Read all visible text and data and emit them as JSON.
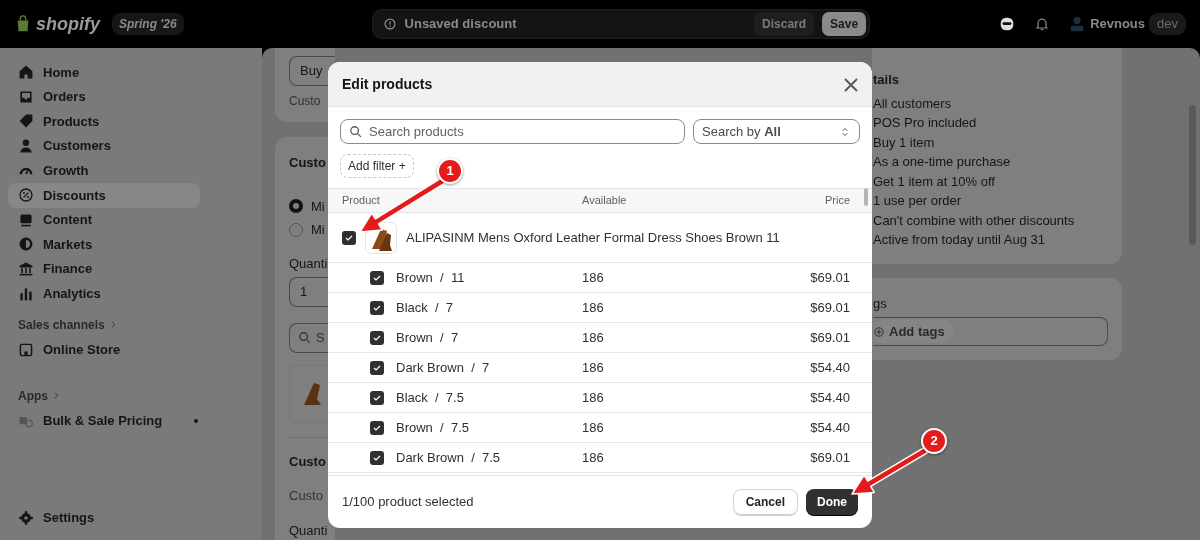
{
  "top_bar": {
    "logo": "shopify",
    "edition": "Spring '26",
    "notice": "Unsaved discount",
    "discard": "Discard",
    "save": "Save",
    "user": "Revnous",
    "user_badge": "dev"
  },
  "sidebar": {
    "items": [
      {
        "label": "Home",
        "selected": false
      },
      {
        "label": "Orders",
        "selected": false
      },
      {
        "label": "Products",
        "selected": false
      },
      {
        "label": "Customers",
        "selected": false
      },
      {
        "label": "Growth",
        "selected": false
      },
      {
        "label": "Discounts",
        "selected": true
      },
      {
        "label": "Content",
        "selected": false
      },
      {
        "label": "Markets",
        "selected": false
      },
      {
        "label": "Finance",
        "selected": false
      },
      {
        "label": "Analytics",
        "selected": false
      }
    ],
    "sales_channels": {
      "heading": "Sales channels",
      "items": [
        {
          "label": "Online Store",
          "selected": false
        }
      ]
    },
    "apps": {
      "heading": "Apps",
      "items": [
        {
          "label": "Bulk & Sale Pricing",
          "selected": false
        }
      ]
    },
    "settings": {
      "label": "Settings",
      "selected": false
    }
  },
  "main": {
    "method_card": {
      "value": "Buy",
      "caption": "Custo"
    },
    "requirements_card": {
      "heading": "Custo",
      "options": [
        {
          "label": "Mi",
          "selected": true
        },
        {
          "label": "Mi",
          "selected": false
        }
      ],
      "quantity_label": "Quanti",
      "quantity_value": "1",
      "search_placeholder": "S",
      "gets_heading": "Custo",
      "gets_caption": "Custo",
      "gets_quantity_label": "Quanti"
    }
  },
  "summary": {
    "heading": "tails",
    "lines": [
      "All customers",
      "POS Pro included",
      "Buy 1 item",
      "As a one-time purchase",
      "Get 1 item at 10% off",
      "1 use per order",
      "Can't combine with other discounts",
      "Active from today until Aug 31"
    ]
  },
  "tags": {
    "heading": "gs",
    "button": "Add tags"
  },
  "modal": {
    "title": "Edit products",
    "search": {
      "placeholder": "Search products"
    },
    "search_by": "Search by **All**",
    "add_filter": "Add filter +",
    "table": {
      "columns": [
        "Product",
        "Available",
        "Price"
      ],
      "product": {
        "title": "ALIPASINM Mens Oxford Leather Formal Dress Shoes Brown 11",
        "checked": true
      },
      "variants": [
        {
          "label": "Brown  /  11",
          "available": "186",
          "price": "$69.01",
          "checked": true
        },
        {
          "label": "Black  /  7",
          "available": "186",
          "price": "$69.01",
          "checked": true
        },
        {
          "label": "Brown  /  7",
          "available": "186",
          "price": "$69.01",
          "checked": true
        },
        {
          "label": "Dark Brown  /  7",
          "available": "186",
          "price": "$54.40",
          "checked": true
        },
        {
          "label": "Black  /  7.5",
          "available": "186",
          "price": "$54.40",
          "checked": true
        },
        {
          "label": "Brown  /  7.5",
          "available": "186",
          "price": "$54.40",
          "checked": true
        },
        {
          "label": "Dark Brown  /  7.5",
          "available": "186",
          "price": "$69.01",
          "checked": true
        }
      ]
    },
    "footer": {
      "status": "1/100 product selected",
      "cancel": "Cancel",
      "done": "Done"
    }
  },
  "annotations": [
    {
      "label": "1"
    },
    {
      "label": "2"
    }
  ]
}
